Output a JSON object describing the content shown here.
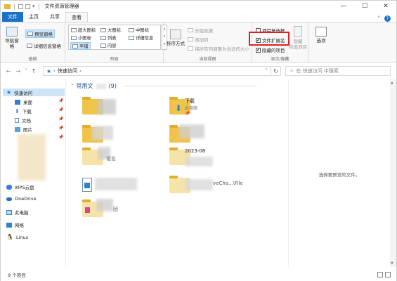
{
  "window": {
    "title": "文件资源管理器",
    "controls": {
      "minimize": "—",
      "maximize": "☐",
      "close": "✕"
    }
  },
  "tabs": {
    "file": "文件",
    "home": "主页",
    "share": "共享",
    "view": "查看",
    "collapse": "˅",
    "help": "?"
  },
  "ribbon": {
    "panes": {
      "label": "窗格",
      "nav_pane": "导航窗格",
      "preview_pane": "预览窗格",
      "details_pane": "详细信息窗格"
    },
    "layout": {
      "label": "布局",
      "items": [
        "超大图标",
        "大图标",
        "中图标",
        "小图标",
        "列表",
        "详细信息",
        "平铺",
        "内容"
      ]
    },
    "current_view": {
      "label": "当前视图",
      "sort_by": "排序方式",
      "group_by": "分组依据",
      "add_columns": "添加列",
      "size_all_columns": "将所有列调整为合适的大小"
    },
    "show_hide": {
      "label": "显示/隐藏",
      "item_checkboxes": "项目复选框",
      "file_extensions": "文件扩展名",
      "hidden_items": "隐藏的项目",
      "hide_selected": "隐藏",
      "hide_selected_2": "所选项目",
      "checked_mark": "✔"
    },
    "options": "选项"
  },
  "navbar": {
    "back": "←",
    "forward": "→",
    "recent": "˅",
    "up": "↑",
    "path": "快速访问",
    "path_sep": "›",
    "refresh": "↻",
    "search_placeholder": "在 快速访问 中搜索"
  },
  "navpane": {
    "quick_access": "快速访问",
    "desktop": "桌面",
    "downloads": "下载",
    "documents": "文档",
    "pictures": "图片",
    "wps": "WPS云盘",
    "onedrive": "OneDrive",
    "this_pc": "此电脑",
    "network": "网络",
    "linux": "Linux"
  },
  "content": {
    "group_title": "常用文",
    "group_count": "(9)",
    "downloads_name": "下载",
    "downloads_sub": "此电脑",
    "date_fragment": "2023-08",
    "path_fragment": "veCha...\\File",
    "name_fragment": "证名",
    "name_fragment2": "团"
  },
  "preview": {
    "message": "选择要预览的文件。"
  },
  "status": {
    "count": "9 个项目"
  }
}
